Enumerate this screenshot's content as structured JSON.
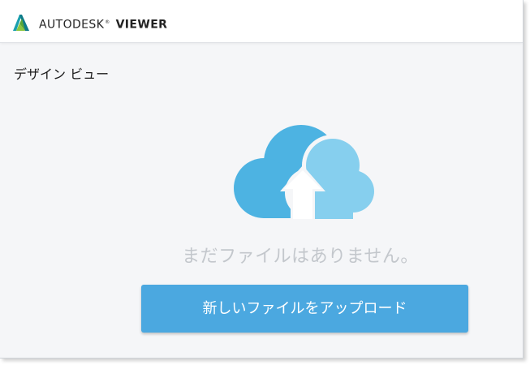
{
  "header": {
    "brand_name": "AUTODESK",
    "brand_reg": "®",
    "product_name": "VIEWER",
    "logo_icon": "autodesk-logo-icon"
  },
  "main": {
    "section_title": "デザイン ビュー",
    "empty_icon": "cloud-upload-icon",
    "empty_message": "まだファイルはありません。",
    "upload_button_label": "新しいファイルをアップロード"
  },
  "colors": {
    "accent": "#4ba8e0",
    "cloud_dark": "#4db3e2",
    "cloud_light": "#86cfee",
    "empty_text": "#c3c7cc",
    "background": "#f5f6f8"
  }
}
